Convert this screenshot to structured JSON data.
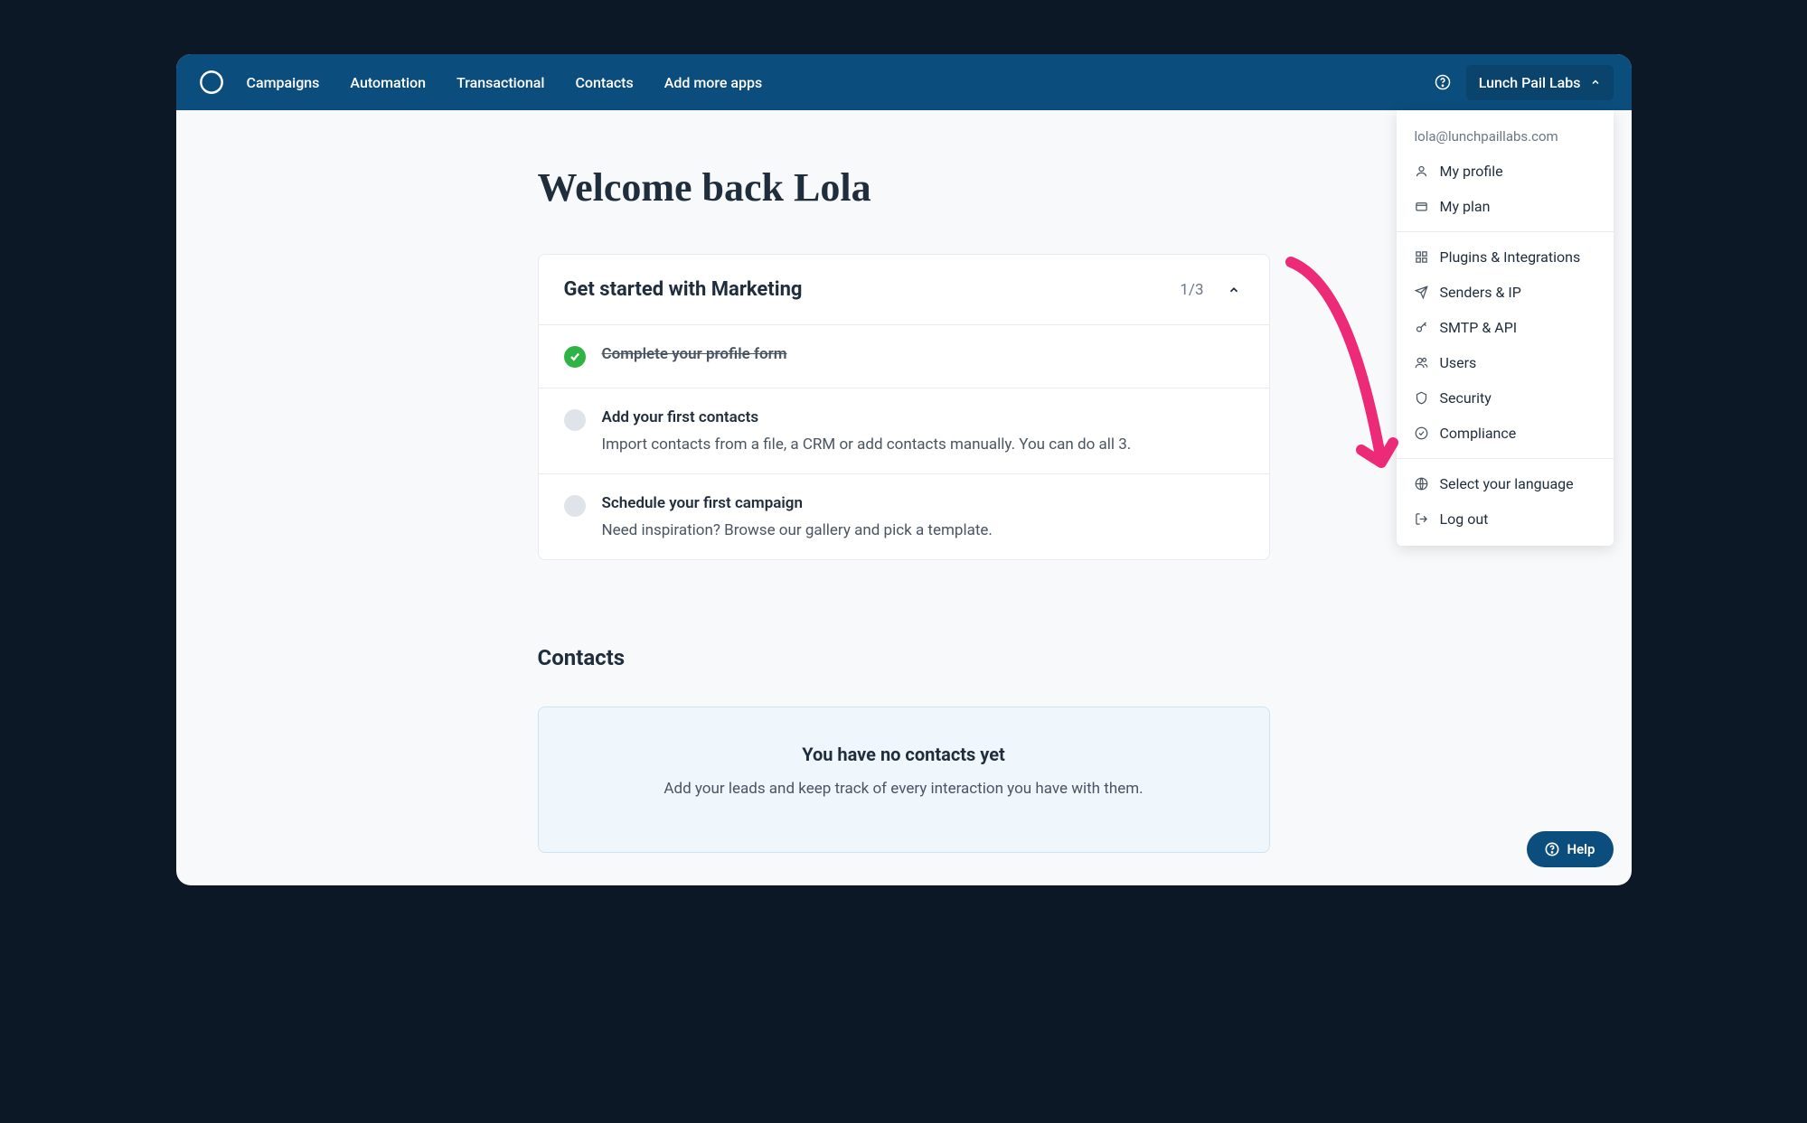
{
  "nav": {
    "items": [
      "Campaigns",
      "Automation",
      "Transactional",
      "Contacts",
      "Add more apps"
    ],
    "account_label": "Lunch Pail Labs"
  },
  "welcome_title": "Welcome back Lola",
  "getting_started": {
    "title": "Get started with Marketing",
    "progress": "1/3",
    "steps": [
      {
        "title": "Complete your profile form",
        "done": true
      },
      {
        "title": "Add your first contacts",
        "desc": "Import contacts from a file, a CRM or add contacts manually. You can do all 3.",
        "done": false
      },
      {
        "title": "Schedule your first campaign",
        "desc": "Need inspiration? Browse our gallery and pick a template.",
        "done": false
      }
    ]
  },
  "contacts_section": {
    "title": "Contacts",
    "empty_title": "You have no contacts yet",
    "empty_desc": "Add your leads and keep track of every interaction you have with them."
  },
  "dropdown": {
    "email": "lola@lunchpaillabs.com",
    "groups": [
      [
        "My profile",
        "My plan"
      ],
      [
        "Plugins & Integrations",
        "Senders & IP",
        "SMTP & API",
        "Users",
        "Security",
        "Compliance"
      ],
      [
        "Select your language",
        "Log out"
      ]
    ]
  },
  "help_pill": "Help"
}
